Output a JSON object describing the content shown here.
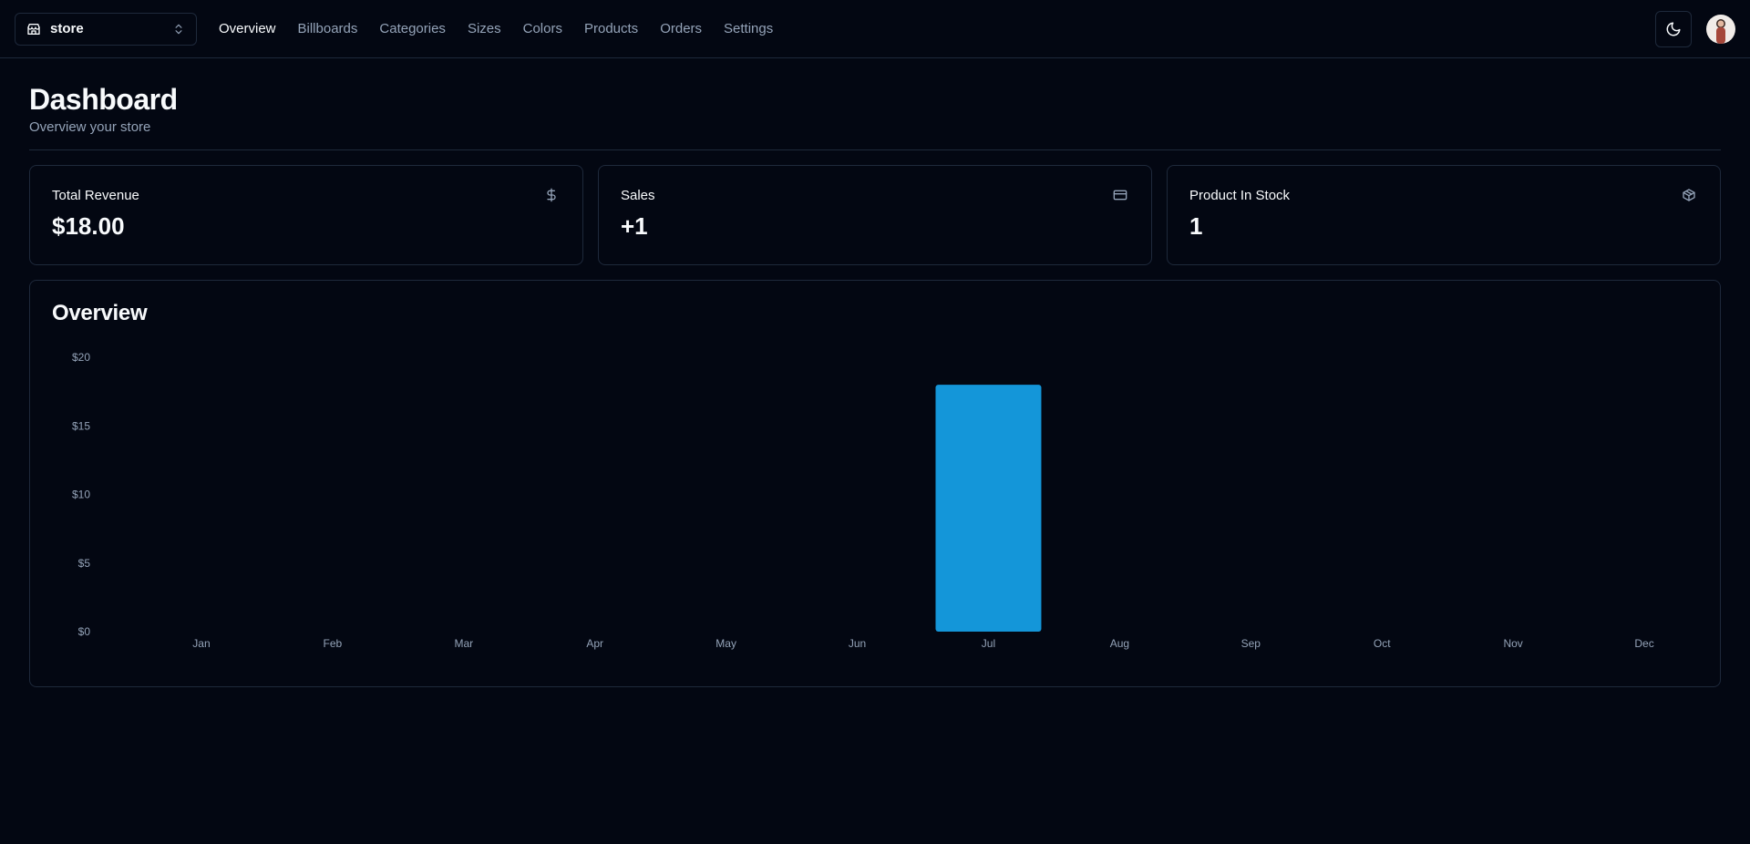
{
  "store_switcher": {
    "name": "store"
  },
  "nav": [
    {
      "label": "Overview",
      "active": true
    },
    {
      "label": "Billboards",
      "active": false
    },
    {
      "label": "Categories",
      "active": false
    },
    {
      "label": "Sizes",
      "active": false
    },
    {
      "label": "Colors",
      "active": false
    },
    {
      "label": "Products",
      "active": false
    },
    {
      "label": "Orders",
      "active": false
    },
    {
      "label": "Settings",
      "active": false
    }
  ],
  "header": {
    "title": "Dashboard",
    "subtitle": "Overview your store"
  },
  "cards": [
    {
      "title": "Total Revenue",
      "value": "$18.00",
      "icon": "dollar-icon"
    },
    {
      "title": "Sales",
      "value": "+1",
      "icon": "credit-card-icon"
    },
    {
      "title": "Product In Stock",
      "value": "1",
      "icon": "package-icon"
    }
  ],
  "overview": {
    "title": "Overview"
  },
  "chart_data": {
    "type": "bar",
    "categories": [
      "Jan",
      "Feb",
      "Mar",
      "Apr",
      "May",
      "Jun",
      "Jul",
      "Aug",
      "Sep",
      "Oct",
      "Nov",
      "Dec"
    ],
    "values": [
      0,
      0,
      0,
      0,
      0,
      0,
      18,
      0,
      0,
      0,
      0,
      0
    ],
    "yticks": [
      "$0",
      "$5",
      "$10",
      "$15",
      "$20"
    ],
    "ylim": [
      0,
      20
    ],
    "grid": false,
    "bar_color": "#1496d9"
  },
  "colors": {
    "background": "#030712",
    "border": "#1e293b",
    "muted": "#94a3b8",
    "accent": "#1496d9"
  }
}
